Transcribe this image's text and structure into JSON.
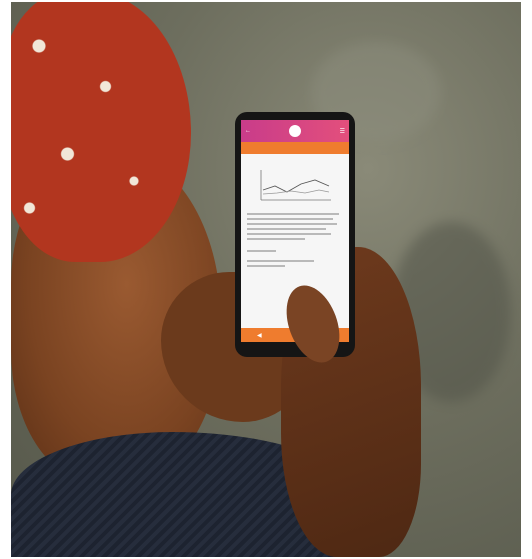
{
  "app": {
    "screen_title": "",
    "subheader": "",
    "accent_pink": "#c93c8a",
    "accent_orange": "#ef7c2e"
  },
  "icons": {
    "back": "left-arrow-icon",
    "menu": "menu-icon",
    "nav_back": "triangle-back-icon",
    "nav_home": "circle-home-icon",
    "nav_recent": "square-recent-icon"
  }
}
